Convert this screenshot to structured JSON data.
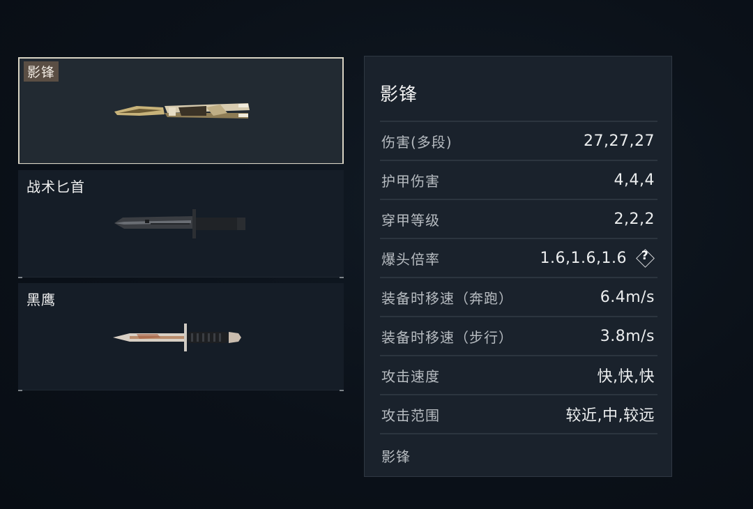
{
  "weapons": [
    {
      "name": "影锋",
      "selected": true
    },
    {
      "name": "战术匕首",
      "selected": false
    },
    {
      "name": "黑鹰",
      "selected": false
    }
  ],
  "detail": {
    "title": "影锋",
    "stats": [
      {
        "label": "伤害(多段)",
        "value": "27,27,27"
      },
      {
        "label": "护甲伤害",
        "value": "4,4,4"
      },
      {
        "label": "穿甲等级",
        "value": "2,2,2"
      },
      {
        "label": "爆头倍率",
        "value": "1.6,1.6,1.6",
        "help": "?"
      },
      {
        "label": "装备时移速（奔跑）",
        "value": "6.4m/s"
      },
      {
        "label": "装备时移速（步行）",
        "value": "3.8m/s"
      },
      {
        "label": "攻击速度",
        "value": "快,快,快"
      },
      {
        "label": "攻击范围",
        "value": "较近,中,较远"
      }
    ],
    "footer": "影锋"
  },
  "colors": {
    "selected_outline": "#d9d4c4",
    "selected_tag_bg": "#5a4e44",
    "panel_bg": "#1a222c"
  },
  "icons": {
    "help": "help-diamond-icon",
    "weapon_1": "butterfly-knife-icon",
    "weapon_2": "tactical-knife-icon",
    "weapon_3": "dagger-knife-icon"
  }
}
